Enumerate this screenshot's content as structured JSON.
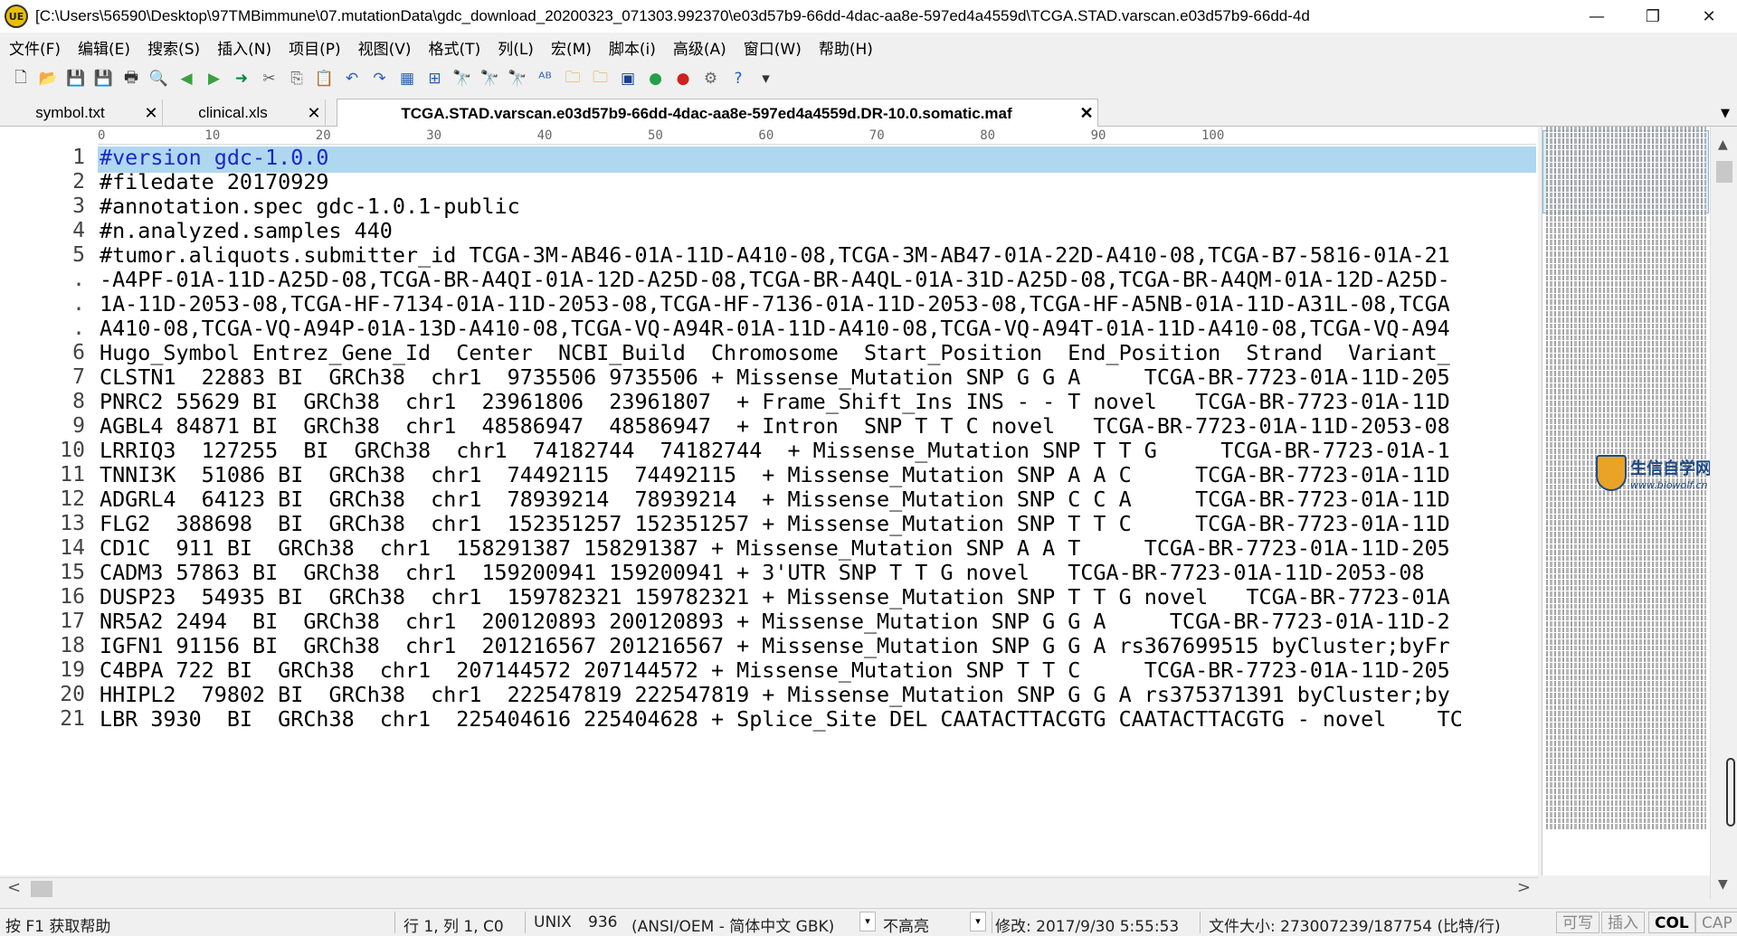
{
  "window": {
    "title": "[C:\\Users\\56590\\Desktop\\97TMBimmune\\07.mutationData\\gdc_download_20200323_071303.992370\\e03d57b9-66dd-4dac-aa8e-597ed4a4559d\\TCGA.STAD.varscan.e03d57b9-66dd-4d",
    "app_icon_label": "UE",
    "minimize": "—",
    "restore": "❐",
    "close": "✕"
  },
  "menu": [
    "文件(F)",
    "编辑(E)",
    "搜索(S)",
    "插入(N)",
    "项目(P)",
    "视图(V)",
    "格式(T)",
    "列(L)",
    "宏(M)",
    "脚本(i)",
    "高级(A)",
    "窗口(W)",
    "帮助(H)"
  ],
  "toolbar_icons": [
    {
      "name": "new-file-icon",
      "glyph": "🗋",
      "color": "#333333"
    },
    {
      "name": "open-folder-icon",
      "glyph": "📂",
      "color": "#d9a520"
    },
    {
      "name": "save-icon",
      "glyph": "💾",
      "color": "#a0368a"
    },
    {
      "name": "save-all-icon",
      "glyph": "💾",
      "color": "#a0368a"
    },
    {
      "name": "print-icon",
      "glyph": "🖶",
      "color": "#333333"
    },
    {
      "name": "print-preview-icon",
      "glyph": "🔍",
      "color": "#333333"
    },
    {
      "name": "back-icon",
      "glyph": "◀",
      "color": "#3aa040"
    },
    {
      "name": "forward-icon",
      "glyph": "▶",
      "color": "#3aa040"
    },
    {
      "name": "goto-icon",
      "glyph": "➜",
      "color": "#0a8a3a"
    },
    {
      "name": "cut-icon",
      "glyph": "✂",
      "color": "#666666"
    },
    {
      "name": "copy-icon",
      "glyph": "⎘",
      "color": "#666666"
    },
    {
      "name": "paste-icon",
      "glyph": "📋",
      "color": "#b07820"
    },
    {
      "name": "undo-icon",
      "glyph": "↶",
      "color": "#2b5fb0"
    },
    {
      "name": "redo-icon",
      "glyph": "↷",
      "color": "#2b5fb0"
    },
    {
      "name": "column-mode-icon",
      "glyph": "▦",
      "color": "#2b5fb0"
    },
    {
      "name": "hex-mode-icon",
      "glyph": "⊞",
      "color": "#2b5fb0"
    },
    {
      "name": "find-icon",
      "glyph": "🔭",
      "color": "#333333"
    },
    {
      "name": "find-next-icon",
      "glyph": "🔭",
      "color": "#555555"
    },
    {
      "name": "find-prev-icon",
      "glyph": "🔭",
      "color": "#555555"
    },
    {
      "name": "spell-check-icon",
      "glyph": "ᴬᴮ",
      "color": "#2b5fb0"
    },
    {
      "name": "find-in-files-icon",
      "glyph": "🗀",
      "color": "#d9a520"
    },
    {
      "name": "replace-in-files-icon",
      "glyph": "🗀",
      "color": "#d9a520"
    },
    {
      "name": "run-macro-icon",
      "glyph": "▣",
      "color": "#1c3e8a"
    },
    {
      "name": "start-record-icon",
      "glyph": "●",
      "color": "#22a04a"
    },
    {
      "name": "stop-record-icon",
      "glyph": "●",
      "color": "#d02020"
    },
    {
      "name": "settings-icon",
      "glyph": "⚙",
      "color": "#666666"
    },
    {
      "name": "help-icon",
      "glyph": "?",
      "color": "#1c5fc0"
    },
    {
      "name": "toolbar-more-icon",
      "glyph": "▾",
      "color": "#333333"
    }
  ],
  "tabs": [
    {
      "label": "symbol.txt",
      "close": "✕",
      "active": false
    },
    {
      "label": "clinical.xls",
      "close": "✕",
      "active": false
    },
    {
      "label": "TCGA.STAD.varscan.e03d57b9-66dd-4dac-aa8e-597ed4a4559d.DR-10.0.somatic.maf",
      "close": "✕",
      "active": true
    }
  ],
  "tab_list_arrow": "▼",
  "ruler": [
    "0",
    "10",
    "20",
    "30",
    "40",
    "50",
    "60",
    "70",
    "80",
    "90",
    "100"
  ],
  "line_numbers": [
    "1",
    "2",
    "3",
    "4",
    "5",
    ".",
    ".",
    ".",
    "6",
    "7",
    "8",
    "9",
    "10",
    "11",
    "12",
    "13",
    "14",
    "15",
    "16",
    "17",
    "18",
    "19",
    "20",
    "21"
  ],
  "lines": [
    "#version gdc-1.0.0",
    "#filedate 20170929",
    "#annotation.spec gdc-1.0.1-public",
    "#n.analyzed.samples 440",
    "#tumor.aliquots.submitter_id TCGA-3M-AB46-01A-11D-A410-08,TCGA-3M-AB47-01A-22D-A410-08,TCGA-B7-5816-01A-21",
    "-A4PF-01A-11D-A25D-08,TCGA-BR-A4QI-01A-12D-A25D-08,TCGA-BR-A4QL-01A-31D-A25D-08,TCGA-BR-A4QM-01A-12D-A25D-",
    "1A-11D-2053-08,TCGA-HF-7134-01A-11D-2053-08,TCGA-HF-7136-01A-11D-2053-08,TCGA-HF-A5NB-01A-11D-A31L-08,TCGA",
    "A410-08,TCGA-VQ-A94P-01A-13D-A410-08,TCGA-VQ-A94R-01A-11D-A410-08,TCGA-VQ-A94T-01A-11D-A410-08,TCGA-VQ-A94",
    "Hugo_Symbol Entrez_Gene_Id  Center  NCBI_Build  Chromosome  Start_Position  End_Position  Strand  Variant_",
    "CLSTN1  22883 BI  GRCh38  chr1  9735506 9735506 + Missense_Mutation SNP G G A     TCGA-BR-7723-01A-11D-205",
    "PNRC2 55629 BI  GRCh38  chr1  23961806  23961807  + Frame_Shift_Ins INS - - T novel   TCGA-BR-7723-01A-11D",
    "AGBL4 84871 BI  GRCh38  chr1  48586947  48586947  + Intron  SNP T T C novel   TCGA-BR-7723-01A-11D-2053-08",
    "LRRIQ3  127255  BI  GRCh38  chr1  74182744  74182744  + Missense_Mutation SNP T T G     TCGA-BR-7723-01A-1",
    "TNNI3K  51086 BI  GRCh38  chr1  74492115  74492115  + Missense_Mutation SNP A A C     TCGA-BR-7723-01A-11D",
    "ADGRL4  64123 BI  GRCh38  chr1  78939214  78939214  + Missense_Mutation SNP C C A     TCGA-BR-7723-01A-11D",
    "FLG2  388698  BI  GRCh38  chr1  152351257 152351257 + Missense_Mutation SNP T T C     TCGA-BR-7723-01A-11D",
    "CD1C  911 BI  GRCh38  chr1  158291387 158291387 + Missense_Mutation SNP A A T     TCGA-BR-7723-01A-11D-205",
    "CADM3 57863 BI  GRCh38  chr1  159200941 159200941 + 3'UTR SNP T T G novel   TCGA-BR-7723-01A-11D-2053-08",
    "DUSP23  54935 BI  GRCh38  chr1  159782321 159782321 + Missense_Mutation SNP T T G novel   TCGA-BR-7723-01A",
    "NR5A2 2494  BI  GRCh38  chr1  200120893 200120893 + Missense_Mutation SNP G G A     TCGA-BR-7723-01A-11D-2",
    "IGFN1 91156 BI  GRCh38  chr1  201216567 201216567 + Missense_Mutation SNP G G A rs367699515 byCluster;byFr",
    "C4BPA 722 BI  GRCh38  chr1  207144572 207144572 + Missense_Mutation SNP T T C     TCGA-BR-7723-01A-11D-205",
    "HHIPL2  79802 BI  GRCh38  chr1  222547819 222547819 + Missense_Mutation SNP G G A rs375371391 byCluster;by",
    "LBR 3930  BI  GRCh38  chr1  225404616 225404628 + Splice_Site DEL CAATACTTACGTG CAATACTTACGTG - novel    TC"
  ],
  "watermark": {
    "title": "生信自学网",
    "url": "www.biowolf.cn"
  },
  "scroll": {
    "left": "<",
    "right": ">",
    "up": "▲",
    "down": "▼"
  },
  "status": {
    "help": "按 F1 获取帮助",
    "position": "行 1, 列 1, C0",
    "line_ending": "UNIX",
    "codepage": "936",
    "encoding": "(ANSI/OEM - 简体中文 GBK)",
    "highlight": "不高亮",
    "modified": "修改:   2017/9/30 5:55:53",
    "filesize": "文件大小:   273007239/187754   (比特/行)",
    "writable": "可写",
    "insert": "插入",
    "col": "COL",
    "cap": "CAP"
  },
  "colors": {
    "current_line": "#b0d7f0",
    "current_line_text": "#1a27c9"
  }
}
